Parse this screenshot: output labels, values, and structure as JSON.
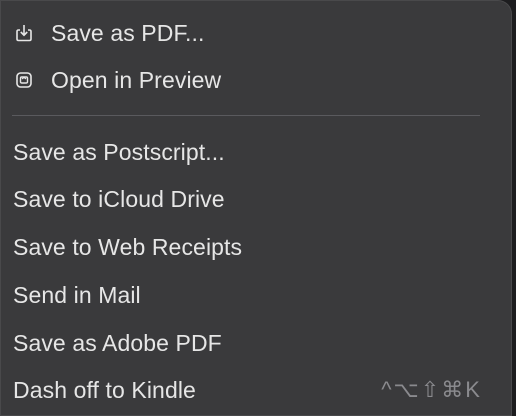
{
  "menu": {
    "top_items": [
      {
        "label": "Save as PDF...",
        "icon": "save-pdf-icon"
      },
      {
        "label": "Open in Preview",
        "icon": "preview-icon"
      }
    ],
    "items": [
      {
        "label": "Save as Postscript..."
      },
      {
        "label": "Save to iCloud Drive"
      },
      {
        "label": "Save to Web Receipts"
      },
      {
        "label": "Send in Mail"
      },
      {
        "label": "Save as Adobe PDF"
      },
      {
        "label": "Dash off to Kindle",
        "shortcut": "^⌥⇧⌘K"
      }
    ]
  }
}
